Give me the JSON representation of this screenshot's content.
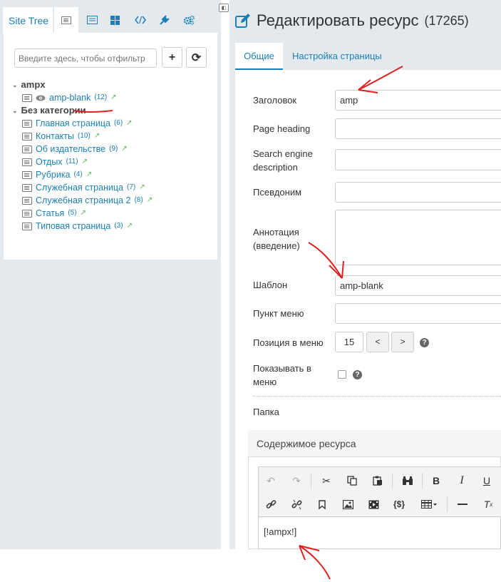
{
  "left_panel": {
    "site_tree_tab": "Site Tree",
    "filter_placeholder": "Введите здесь, чтобы отфильтр",
    "add_button": "+",
    "refresh_button": "⟳",
    "tree": [
      {
        "name": "ampx",
        "items": [
          {
            "label": "amp-blank",
            "count": "(12)"
          }
        ]
      },
      {
        "name": "Без категории",
        "items": [
          {
            "label": "Главная страница",
            "count": "(6)"
          },
          {
            "label": "Контакты",
            "count": "(10)"
          },
          {
            "label": "Об издательстве",
            "count": "(9)"
          },
          {
            "label": "Отдых",
            "count": "(11)"
          },
          {
            "label": "Рубрика",
            "count": "(4)"
          },
          {
            "label": "Служебная страница",
            "count": "(7)"
          },
          {
            "label": "Служебная страница 2",
            "count": "(8)"
          },
          {
            "label": "Статья",
            "count": "(5)"
          },
          {
            "label": "Типовая страница",
            "count": "(3)"
          }
        ]
      }
    ]
  },
  "header": {
    "title": "Редактировать ресурс",
    "resource_id": "(17265)"
  },
  "tabs": {
    "general": "Общие",
    "page_settings": "Настройка страницы"
  },
  "form": {
    "title_label": "Заголовок",
    "title_value": "amp",
    "page_heading_label": "Page heading",
    "seo_desc_label": "Search engine description",
    "alias_label": "Псевдоним",
    "annotation_label": "Аннотация (введение)",
    "template_label": "Шаблон",
    "template_value": "amp-blank",
    "menu_item_label": "Пункт меню",
    "menu_position_label": "Позиция в меню",
    "menu_position_value": "15",
    "prev": "<",
    "next": ">",
    "show_in_menu_label": "Показывать в меню",
    "folder_label": "Папка"
  },
  "content": {
    "heading": "Содержимое ресурса",
    "editor_text": "[!ampx!]"
  },
  "toolbar_icons": [
    "undo-icon",
    "redo-icon",
    "cut-icon",
    "copy-icon",
    "paste-icon",
    "find-icon",
    "bold-icon",
    "italic-icon",
    "underline-icon",
    "link-icon",
    "unlink-icon",
    "bookmark-icon",
    "image-icon",
    "media-icon",
    "snippet-icon",
    "table-icon",
    "hr-icon",
    "clear-format-icon"
  ],
  "colors": {
    "accent": "#1a7fb7",
    "panel_bg": "#e4e9ee",
    "annotation": "#e02020",
    "ext_link": "#54b84e"
  }
}
